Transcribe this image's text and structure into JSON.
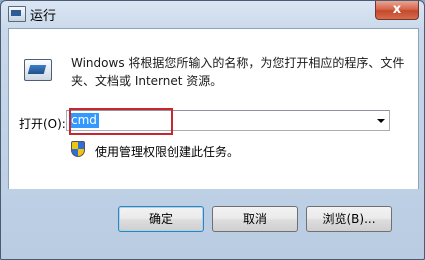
{
  "window": {
    "title": "运行",
    "close_glyph": "x"
  },
  "description": "Windows 将根据您所输入的名称，为您打开相应的程序、文件夹、文档或 Internet 资源。",
  "open": {
    "label": "打开(O):",
    "value": "cmd"
  },
  "admin_note": "使用管理权限创建此任务。",
  "buttons": {
    "ok": "确定",
    "cancel": "取消",
    "browse": "浏览(B)..."
  },
  "colors": {
    "selection": "#3399ff",
    "highlight_box": "#c6262e",
    "close_button": "#c24a2d"
  }
}
